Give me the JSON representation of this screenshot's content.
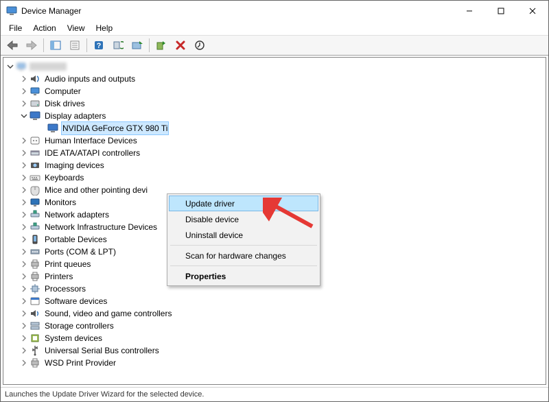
{
  "window": {
    "title": "Device Manager"
  },
  "menubar": {
    "file": "File",
    "action": "Action",
    "view": "View",
    "help": "Help"
  },
  "toolbar": {
    "back": "Back",
    "forward": "Forward",
    "show_hide_tree": "Show/Hide Console Tree",
    "properties": "Properties",
    "help": "Help",
    "scan": "Scan for hardware changes",
    "update_driver": "Update Device Driver",
    "enable": "Enable Device",
    "uninstall": "Uninstall Device",
    "legacy": "Add legacy hardware"
  },
  "tree": {
    "root": "PC",
    "nodes": [
      {
        "label": "Audio inputs and outputs",
        "icon": "audio"
      },
      {
        "label": "Computer",
        "icon": "computer"
      },
      {
        "label": "Disk drives",
        "icon": "disk"
      },
      {
        "label": "Display adapters",
        "icon": "display",
        "expanded": true,
        "children": [
          {
            "label": "NVIDIA GeForce GTX 980 Ti",
            "icon": "display",
            "selected": true
          }
        ]
      },
      {
        "label": "Human Interface Devices",
        "icon": "hid"
      },
      {
        "label": "IDE ATA/ATAPI controllers",
        "icon": "ide"
      },
      {
        "label": "Imaging devices",
        "icon": "imaging"
      },
      {
        "label": "Keyboards",
        "icon": "keyboard"
      },
      {
        "label": "Mice and other pointing devices",
        "icon": "mouse",
        "truncated": "Mice and other pointing devi"
      },
      {
        "label": "Monitors",
        "icon": "monitor"
      },
      {
        "label": "Network adapters",
        "icon": "network"
      },
      {
        "label": "Network Infrastructure Devices",
        "icon": "network"
      },
      {
        "label": "Portable Devices",
        "icon": "portable"
      },
      {
        "label": "Ports (COM & LPT)",
        "icon": "ports"
      },
      {
        "label": "Print queues",
        "icon": "printq"
      },
      {
        "label": "Printers",
        "icon": "printer"
      },
      {
        "label": "Processors",
        "icon": "cpu"
      },
      {
        "label": "Software devices",
        "icon": "software"
      },
      {
        "label": "Sound, video and game controllers",
        "icon": "sound"
      },
      {
        "label": "Storage controllers",
        "icon": "storage"
      },
      {
        "label": "System devices",
        "icon": "system"
      },
      {
        "label": "Universal Serial Bus controllers",
        "icon": "usb"
      },
      {
        "label": "WSD Print Provider",
        "icon": "printq"
      }
    ]
  },
  "context_menu": {
    "update": "Update driver",
    "disable": "Disable device",
    "uninstall": "Uninstall device",
    "scan": "Scan for hardware changes",
    "props": "Properties"
  },
  "statusbar": {
    "text": "Launches the Update Driver Wizard for the selected device."
  },
  "icons": {
    "audio": "speaker-icon",
    "computer": "computer-icon",
    "disk": "disk-icon",
    "display": "display-icon",
    "hid": "hid-icon",
    "ide": "ide-icon",
    "imaging": "camera-icon",
    "keyboard": "keyboard-icon",
    "mouse": "mouse-icon",
    "monitor": "monitor-icon",
    "network": "network-icon",
    "portable": "portable-icon",
    "ports": "ports-icon",
    "printq": "printqueue-icon",
    "printer": "printer-icon",
    "cpu": "cpu-icon",
    "software": "software-icon",
    "sound": "sound-icon",
    "storage": "storage-icon",
    "system": "system-icon",
    "usb": "usb-icon"
  }
}
